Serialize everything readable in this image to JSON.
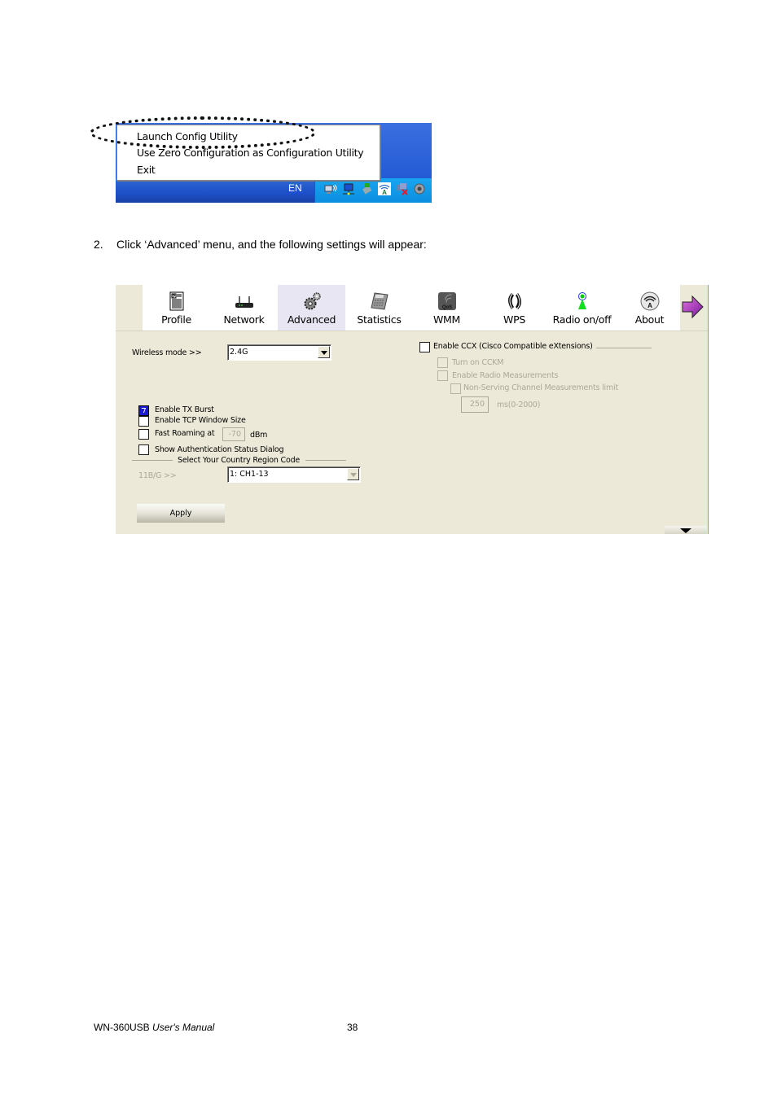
{
  "tray_screenshot": {
    "context_menu": {
      "items": [
        "Launch Config Utility",
        "Use Zero Configuration as Configuration Utility",
        "Exit"
      ],
      "highlighted_item": "Launch Config Utility"
    },
    "language_indicator": "EN",
    "tray_icons": [
      "wireless-network-icon",
      "lan-connection-icon",
      "usb-device-icon",
      "wireless-utility-icon",
      "network-disconnected-icon",
      "volume-icon"
    ]
  },
  "instruction": {
    "number": "2.",
    "text": "Click ‘Advanced’ menu, and the following settings will appear:"
  },
  "config_utility": {
    "toolbar": {
      "items": [
        {
          "label": "Profile",
          "icon": "profile-icon"
        },
        {
          "label": "Network",
          "icon": "router-icon"
        },
        {
          "label": "Advanced",
          "icon": "gears-icon",
          "active": true
        },
        {
          "label": "Statistics",
          "icon": "calculator-icon"
        },
        {
          "label": "WMM",
          "icon": "qos-icon"
        },
        {
          "label": "WPS",
          "icon": "wps-icon"
        },
        {
          "label": "Radio on/off",
          "icon": "antenna-icon"
        },
        {
          "label": "About",
          "icon": "about-icon"
        }
      ],
      "next_icon": "arrow-right-icon"
    },
    "wireless_mode": {
      "label": "Wireless mode >>",
      "value": "2.4G"
    },
    "options": {
      "tx_burst": {
        "label": "Enable TX Burst",
        "checked": true
      },
      "tcp_window": {
        "label": "Enable TCP Window Size",
        "checked": false
      },
      "fast_roaming": {
        "label": "Fast Roaming at",
        "checked": false,
        "value": "-70",
        "unit": "dBm"
      },
      "auth_dialog": {
        "label": "Show Authentication Status Dialog",
        "checked": false
      }
    },
    "country_region": {
      "group_label": "Select Your Country Region Code",
      "label": "11B/G >>",
      "value": "1: CH1-13"
    },
    "ccx": {
      "label": "Enable CCX (Cisco Compatible eXtensions)",
      "checked": false,
      "cckm": {
        "label": "Turn on CCKM",
        "checked": false,
        "disabled": true
      },
      "radio_measurements": {
        "label": "Enable Radio Measurements",
        "checked": false,
        "disabled": true
      },
      "non_serving": {
        "label": "Non-Serving Channel Measurements limit",
        "checked": false,
        "disabled": true
      },
      "limit_value": "250",
      "limit_unit": "ms(0-2000)"
    },
    "apply_label": "Apply"
  },
  "footer": {
    "product": "WN-360USB",
    "manual": "User's Manual",
    "page": "38"
  }
}
